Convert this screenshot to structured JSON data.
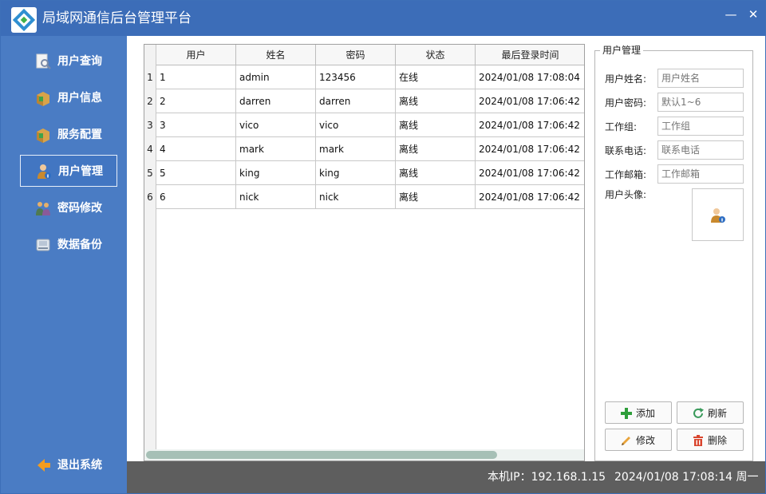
{
  "window": {
    "title": "局域网通信后台管理平台",
    "minimize_glyph": "—",
    "close_glyph": "✕"
  },
  "sidebar": {
    "items": [
      {
        "label": "用户查询",
        "icon": "search-doc-icon"
      },
      {
        "label": "用户信息",
        "icon": "package-icon"
      },
      {
        "label": "服务配置",
        "icon": "package-icon"
      },
      {
        "label": "用户管理",
        "icon": "user-icon",
        "active": true
      },
      {
        "label": "密码修改",
        "icon": "key-users-icon"
      },
      {
        "label": "数据备份",
        "icon": "disk-icon"
      }
    ],
    "exit": {
      "label": "退出系统",
      "icon": "exit-arrow-icon"
    }
  },
  "table": {
    "columns": [
      "用户",
      "姓名",
      "密码",
      "状态",
      "最后登录时间"
    ],
    "rows": [
      {
        "num": "1",
        "cells": [
          "1",
          "admin",
          "123456",
          "在线",
          "2024/01/08 17:08:04"
        ]
      },
      {
        "num": "2",
        "cells": [
          "2",
          "darren",
          "darren",
          "离线",
          "2024/01/08 17:06:42"
        ]
      },
      {
        "num": "3",
        "cells": [
          "3",
          "vico",
          "vico",
          "离线",
          "2024/01/08 17:06:42"
        ]
      },
      {
        "num": "4",
        "cells": [
          "4",
          "mark",
          "mark",
          "离线",
          "2024/01/08 17:06:42"
        ]
      },
      {
        "num": "5",
        "cells": [
          "5",
          "king",
          "king",
          "离线",
          "2024/01/08 17:06:42"
        ]
      },
      {
        "num": "6",
        "cells": [
          "6",
          "nick",
          "nick",
          "离线",
          "2024/01/08 17:06:42"
        ]
      }
    ]
  },
  "form": {
    "group_title": "用户管理",
    "fields": [
      {
        "label": "用户姓名:",
        "placeholder": "用户姓名"
      },
      {
        "label": "用户密码:",
        "placeholder": "默认1~6"
      },
      {
        "label": "工作组:",
        "placeholder": "工作组"
      },
      {
        "label": "联系电话:",
        "placeholder": "联系电话"
      },
      {
        "label": "工作邮箱:",
        "placeholder": "工作邮箱"
      }
    ],
    "avatar_label": "用户头像:",
    "buttons": {
      "add": "添加",
      "refresh": "刷新",
      "edit": "修改",
      "delete": "删除"
    }
  },
  "status": {
    "ip": "本机IP：192.168.1.15",
    "time": "2024/01/08 17:08:14 周一"
  },
  "colors": {
    "title_bar": "#3c6db8",
    "sidebar": "#4a7cc4",
    "status_bar": "#5e5e5e",
    "scroll_thumb": "#a6c0b6",
    "add_green": "#2e9e3a",
    "refresh_green": "#3a9a5b",
    "edit_orange": "#e8a33a",
    "delete_red": "#d9452e"
  }
}
